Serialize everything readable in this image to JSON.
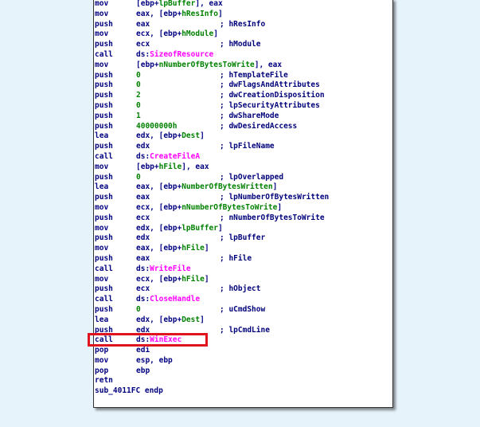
{
  "lines": [
    {
      "m": "mov",
      "segs": [
        {
          "t": "[ebp+",
          "c": "n"
        },
        {
          "t": "lpBuffer",
          "c": "g"
        },
        {
          "t": "], eax",
          "c": "n"
        }
      ],
      "comment": ""
    },
    {
      "m": "mov",
      "segs": [
        {
          "t": "eax, [ebp+",
          "c": "n"
        },
        {
          "t": "hResInfo",
          "c": "g"
        },
        {
          "t": "]",
          "c": "n"
        }
      ],
      "comment": ""
    },
    {
      "m": "push",
      "segs": [
        {
          "t": "eax",
          "c": "n"
        }
      ],
      "comment": "; hResInfo"
    },
    {
      "m": "mov",
      "segs": [
        {
          "t": "ecx, [ebp+",
          "c": "n"
        },
        {
          "t": "hModule",
          "c": "g"
        },
        {
          "t": "]",
          "c": "n"
        }
      ],
      "comment": ""
    },
    {
      "m": "push",
      "segs": [
        {
          "t": "ecx",
          "c": "n"
        }
      ],
      "comment": "; hModule"
    },
    {
      "m": "call",
      "segs": [
        {
          "t": "ds:",
          "c": "n"
        },
        {
          "t": "SizeofResource",
          "c": "m"
        }
      ],
      "comment": ""
    },
    {
      "m": "mov",
      "segs": [
        {
          "t": "[ebp+",
          "c": "n"
        },
        {
          "t": "nNumberOfBytesToWrite",
          "c": "g"
        },
        {
          "t": "], eax",
          "c": "n"
        }
      ],
      "comment": ""
    },
    {
      "m": "push",
      "segs": [
        {
          "t": "0",
          "c": "g"
        }
      ],
      "comment": "; hTemplateFile"
    },
    {
      "m": "push",
      "segs": [
        {
          "t": "0",
          "c": "g"
        }
      ],
      "comment": "; dwFlagsAndAttributes"
    },
    {
      "m": "push",
      "segs": [
        {
          "t": "2",
          "c": "g"
        }
      ],
      "comment": "; dwCreationDisposition"
    },
    {
      "m": "push",
      "segs": [
        {
          "t": "0",
          "c": "g"
        }
      ],
      "comment": "; lpSecurityAttributes"
    },
    {
      "m": "push",
      "segs": [
        {
          "t": "1",
          "c": "g"
        }
      ],
      "comment": "; dwShareMode"
    },
    {
      "m": "push",
      "segs": [
        {
          "t": "40000000h",
          "c": "g"
        }
      ],
      "comment": "; dwDesiredAccess"
    },
    {
      "m": "lea",
      "segs": [
        {
          "t": "edx, [ebp+",
          "c": "n"
        },
        {
          "t": "Dest",
          "c": "g"
        },
        {
          "t": "]",
          "c": "n"
        }
      ],
      "comment": ""
    },
    {
      "m": "push",
      "segs": [
        {
          "t": "edx",
          "c": "n"
        }
      ],
      "comment": "; lpFileName"
    },
    {
      "m": "call",
      "segs": [
        {
          "t": "ds:",
          "c": "n"
        },
        {
          "t": "CreateFileA",
          "c": "m"
        }
      ],
      "comment": ""
    },
    {
      "m": "mov",
      "segs": [
        {
          "t": "[ebp+",
          "c": "n"
        },
        {
          "t": "hFile",
          "c": "g"
        },
        {
          "t": "], eax",
          "c": "n"
        }
      ],
      "comment": ""
    },
    {
      "m": "push",
      "segs": [
        {
          "t": "0",
          "c": "g"
        }
      ],
      "comment": "; lpOverlapped"
    },
    {
      "m": "lea",
      "segs": [
        {
          "t": "eax, [ebp+",
          "c": "n"
        },
        {
          "t": "NumberOfBytesWritten",
          "c": "g"
        },
        {
          "t": "]",
          "c": "n"
        }
      ],
      "comment": ""
    },
    {
      "m": "push",
      "segs": [
        {
          "t": "eax",
          "c": "n"
        }
      ],
      "comment": "; lpNumberOfBytesWritten"
    },
    {
      "m": "mov",
      "segs": [
        {
          "t": "ecx, [ebp+",
          "c": "n"
        },
        {
          "t": "nNumberOfBytesToWrite",
          "c": "g"
        },
        {
          "t": "]",
          "c": "n"
        }
      ],
      "comment": ""
    },
    {
      "m": "push",
      "segs": [
        {
          "t": "ecx",
          "c": "n"
        }
      ],
      "comment": "; nNumberOfBytesToWrite"
    },
    {
      "m": "mov",
      "segs": [
        {
          "t": "edx, [ebp+",
          "c": "n"
        },
        {
          "t": "lpBuffer",
          "c": "g"
        },
        {
          "t": "]",
          "c": "n"
        }
      ],
      "comment": ""
    },
    {
      "m": "push",
      "segs": [
        {
          "t": "edx",
          "c": "n"
        }
      ],
      "comment": "; lpBuffer"
    },
    {
      "m": "mov",
      "segs": [
        {
          "t": "eax, [ebp+",
          "c": "n"
        },
        {
          "t": "hFile",
          "c": "g"
        },
        {
          "t": "]",
          "c": "n"
        }
      ],
      "comment": ""
    },
    {
      "m": "push",
      "segs": [
        {
          "t": "eax",
          "c": "n"
        }
      ],
      "comment": "; hFile"
    },
    {
      "m": "call",
      "segs": [
        {
          "t": "ds:",
          "c": "n"
        },
        {
          "t": "WriteFile",
          "c": "m"
        }
      ],
      "comment": ""
    },
    {
      "m": "mov",
      "segs": [
        {
          "t": "ecx, [ebp+",
          "c": "n"
        },
        {
          "t": "hFile",
          "c": "g"
        },
        {
          "t": "]",
          "c": "n"
        }
      ],
      "comment": ""
    },
    {
      "m": "push",
      "segs": [
        {
          "t": "ecx",
          "c": "n"
        }
      ],
      "comment": "; hObject"
    },
    {
      "m": "call",
      "segs": [
        {
          "t": "ds:",
          "c": "n"
        },
        {
          "t": "CloseHandle",
          "c": "m"
        }
      ],
      "comment": ""
    },
    {
      "m": "push",
      "segs": [
        {
          "t": "0",
          "c": "g"
        }
      ],
      "comment": "; uCmdShow"
    },
    {
      "m": "lea",
      "segs": [
        {
          "t": "edx, [ebp+",
          "c": "n"
        },
        {
          "t": "Dest",
          "c": "g"
        },
        {
          "t": "]",
          "c": "n"
        }
      ],
      "comment": ""
    },
    {
      "m": "push",
      "segs": [
        {
          "t": "edx",
          "c": "n"
        }
      ],
      "comment": "; lpCmdLine"
    },
    {
      "m": "call",
      "segs": [
        {
          "t": "ds:",
          "c": "n"
        },
        {
          "t": "WinExec",
          "c": "m"
        }
      ],
      "comment": ""
    },
    {
      "m": "pop",
      "segs": [
        {
          "t": "edi",
          "c": "n"
        }
      ],
      "comment": ""
    },
    {
      "m": "mov",
      "segs": [
        {
          "t": "esp, ebp",
          "c": "n"
        }
      ],
      "comment": ""
    },
    {
      "m": "pop",
      "segs": [
        {
          "t": "ebp",
          "c": "n"
        }
      ],
      "comment": ""
    },
    {
      "m": "retn",
      "segs": [],
      "comment": ""
    },
    {
      "m": "sub_4011FC endp",
      "segs": [],
      "comment": ""
    }
  ],
  "highlight": {
    "line_index": 33,
    "color": "#e0141e"
  },
  "colors": {
    "background": "#e6f3fa",
    "text": "#000080",
    "name_green": "#008000",
    "name_magenta": "#ff00ff"
  }
}
